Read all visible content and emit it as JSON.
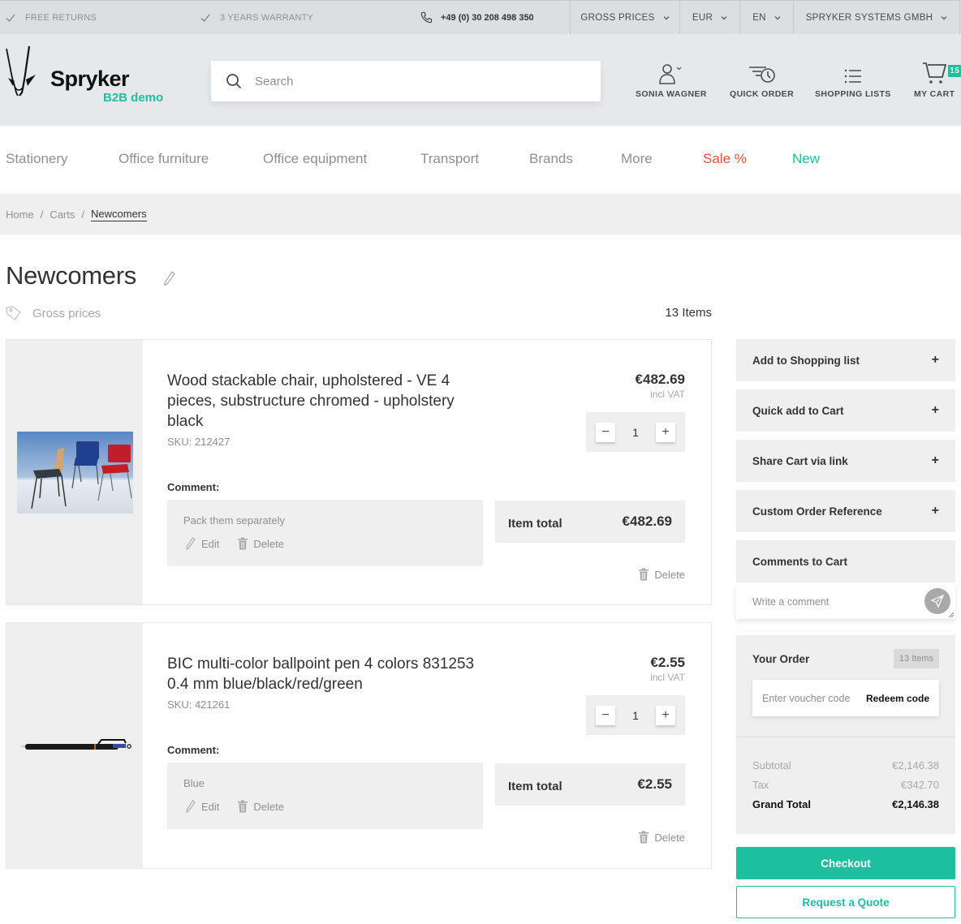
{
  "topbar": {
    "usps": [
      "FREE RETURNS",
      "3 YEARS WARRANTY"
    ],
    "phone": "+49 (0) 30 208 498 350",
    "price_mode": "GROSS PRICES",
    "currency": "EUR",
    "language": "EN",
    "company": "SPRYKER SYSTEMS GMBH"
  },
  "header": {
    "brand": "Spryker",
    "brand_sub": "B2B demo",
    "search_placeholder": "Search",
    "user_label": "SONIA WAGNER",
    "quick_order_label": "QUICK ORDER",
    "shopping_lists_label": "SHOPPING LISTS",
    "cart_label": "MY CART",
    "cart_count": "15"
  },
  "categories": [
    {
      "label": "Stationery",
      "color": "#8d8f92"
    },
    {
      "label": "Office furniture",
      "color": "#8d8f92"
    },
    {
      "label": "Office equipment",
      "color": "#8d8f92"
    },
    {
      "label": "Transport",
      "color": "#8d8f92"
    },
    {
      "label": "Brands",
      "color": "#8d8f92"
    },
    {
      "label": "More",
      "color": "#8d8f92"
    },
    {
      "label": "Sale %",
      "color": "#e3533c"
    },
    {
      "label": "New",
      "color": "#1ebea0"
    }
  ],
  "breadcrumb": [
    "Home",
    "Carts",
    "Newcomers"
  ],
  "cart": {
    "title": "Newcomers",
    "price_mode": "Gross prices",
    "items_count": "13 Items",
    "items": [
      {
        "name": "Wood stackable chair, upholstered - VE 4 pieces, substructure chromed - upholstery black",
        "sku": "SKU: 212427",
        "price": "€482.69",
        "vat": "incl VAT",
        "quantity": "1",
        "comment_label": "Comment:",
        "comment": "Pack them separately",
        "edit_label": "Edit",
        "delete_comment_label": "Delete",
        "total_label": "Item total",
        "total": "€482.69",
        "delete_label": "Delete"
      },
      {
        "name": "BIC multi-color ballpoint pen 4 colors 831253 0.4 mm blue/black/red/green",
        "sku": "SKU: 421261",
        "price": "€2.55",
        "vat": "incl VAT",
        "quantity": "1",
        "comment_label": "Comment:",
        "comment": "Blue",
        "edit_label": "Edit",
        "delete_comment_label": "Delete",
        "total_label": "Item total",
        "total": "€2.55",
        "delete_label": "Delete"
      }
    ]
  },
  "sidebar": {
    "actions": [
      "Add to Shopping list",
      "Quick add to Cart",
      "Share Cart via link",
      "Custom Order Reference"
    ],
    "comments_title": "Comments to Cart",
    "comment_placeholder": "Write a comment",
    "order_title": "Your Order",
    "order_items": "13 Items",
    "voucher_placeholder": "Enter voucher code",
    "redeem_label": "Redeem code",
    "subtotal_label": "Subtotal",
    "subtotal": "€2,146.38",
    "tax_label": "Tax",
    "tax": "€342.70",
    "grand_total_label": "Grand Total",
    "grand_total": "€2,146.38",
    "checkout_label": "Checkout",
    "quote_label": "Request a Quote"
  },
  "colors": {
    "accent": "#1ebea0",
    "sale": "#e3533c"
  }
}
